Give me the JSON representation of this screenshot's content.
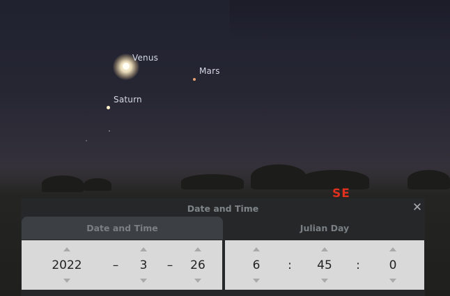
{
  "sky": {
    "planets": [
      {
        "name": "Venus",
        "color": "#fff6dc"
      },
      {
        "name": "Mars",
        "color": "#e8a070"
      },
      {
        "name": "Saturn",
        "color": "#fff2cc"
      }
    ],
    "compass": {
      "label": "SE",
      "color": "#e0301e"
    }
  },
  "dialog": {
    "title": "Date and Time",
    "close_icon": "close-x-icon",
    "tabs": [
      {
        "label": "Date and Time"
      },
      {
        "label": "Julian Day"
      }
    ],
    "date": {
      "year": "2022",
      "month": "3",
      "day": "26",
      "separator": "–"
    },
    "time": {
      "hour": "6",
      "minute": "45",
      "second": "0",
      "separator": ":"
    }
  }
}
